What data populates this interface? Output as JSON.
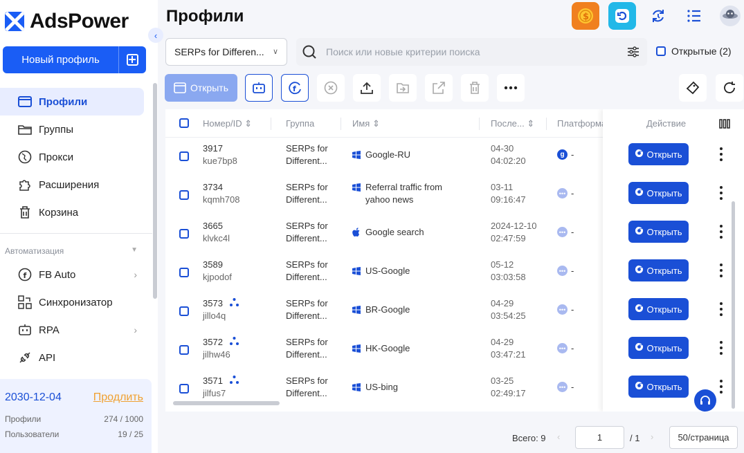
{
  "app": {
    "brand": "AdsPower"
  },
  "sidebar": {
    "new_profile_label": "Новый профиль",
    "items": [
      {
        "label": "Профили",
        "icon": "profiles-icon"
      },
      {
        "label": "Группы",
        "icon": "folder-icon"
      },
      {
        "label": "Прокси",
        "icon": "proxy-icon"
      },
      {
        "label": "Расширения",
        "icon": "puzzle-icon"
      },
      {
        "label": "Корзина",
        "icon": "trash-icon"
      }
    ],
    "automation_title": "Автоматизация",
    "automation_items": [
      {
        "label": "FB Auto",
        "icon": "facebook-icon"
      },
      {
        "label": "Синхронизатор",
        "icon": "sync-icon"
      },
      {
        "label": "RPA",
        "icon": "robot-icon"
      },
      {
        "label": "API",
        "icon": "api-icon"
      }
    ],
    "plan": {
      "expiry": "2030-12-04",
      "renew": "Продлить",
      "profiles_label": "Профили",
      "profiles_value": "274 / 1000",
      "users_label": "Пользователи",
      "users_value": "19 / 25"
    }
  },
  "header": {
    "title": "Профили"
  },
  "filters": {
    "group_select": "SERPs for Differen...",
    "search_placeholder": "Поиск или новые критерии поиска",
    "opened_label": "Открытые (2)"
  },
  "toolbar": {
    "open_label": "Открыть"
  },
  "table": {
    "columns": {
      "id": "Номер/ID",
      "group": "Группа",
      "name": "Имя",
      "last": "После...",
      "platform": "Платформа",
      "action": "Действие"
    },
    "open_label": "Открыть",
    "rows": [
      {
        "num": "3917",
        "id": "kue7bp8",
        "group1": "SERPs for",
        "group2": "Different...",
        "os": "windows",
        "name1": "Google-RU",
        "name2": "",
        "date": "04-30",
        "time": "04:02:20",
        "platform": "g",
        "platform_text": "-",
        "shared": false
      },
      {
        "num": "3734",
        "id": "kqmh708",
        "group1": "SERPs for",
        "group2": "Different...",
        "os": "windows",
        "name1": "Referral traffic from",
        "name2": "yahoo news",
        "date": "03-11",
        "time": "09:16:47",
        "platform": "",
        "platform_text": "-",
        "shared": false
      },
      {
        "num": "3665",
        "id": "klvkc4l",
        "group1": "SERPs for",
        "group2": "Different...",
        "os": "apple",
        "name1": "Google search",
        "name2": "",
        "date": "2024-12-10",
        "time": "02:47:59",
        "platform": "",
        "platform_text": "-",
        "shared": false
      },
      {
        "num": "3589",
        "id": "kjpodof",
        "group1": "SERPs for",
        "group2": "Different...",
        "os": "windows",
        "name1": "US-Google",
        "name2": "",
        "date": "05-12",
        "time": "03:03:58",
        "platform": "",
        "platform_text": "-",
        "shared": false
      },
      {
        "num": "3573",
        "id": "jillo4q",
        "group1": "SERPs for",
        "group2": "Different...",
        "os": "windows",
        "name1": "BR-Google",
        "name2": "",
        "date": "04-29",
        "time": "03:54:25",
        "platform": "",
        "platform_text": "-",
        "shared": true
      },
      {
        "num": "3572",
        "id": "jilhw46",
        "group1": "SERPs for",
        "group2": "Different...",
        "os": "windows",
        "name1": "HK-Google",
        "name2": "",
        "date": "04-29",
        "time": "03:47:21",
        "platform": "",
        "platform_text": "-",
        "shared": true
      },
      {
        "num": "3571",
        "id": "jilfus7",
        "group1": "SERPs for",
        "group2": "Different...",
        "os": "windows",
        "name1": "US-bing",
        "name2": "",
        "date": "03-25",
        "time": "02:49:17",
        "platform": "",
        "platform_text": "-",
        "shared": true
      }
    ]
  },
  "pagination": {
    "total": "Всего: 9",
    "page": "1",
    "pages": "/ 1",
    "per_page": "50/страница"
  }
}
